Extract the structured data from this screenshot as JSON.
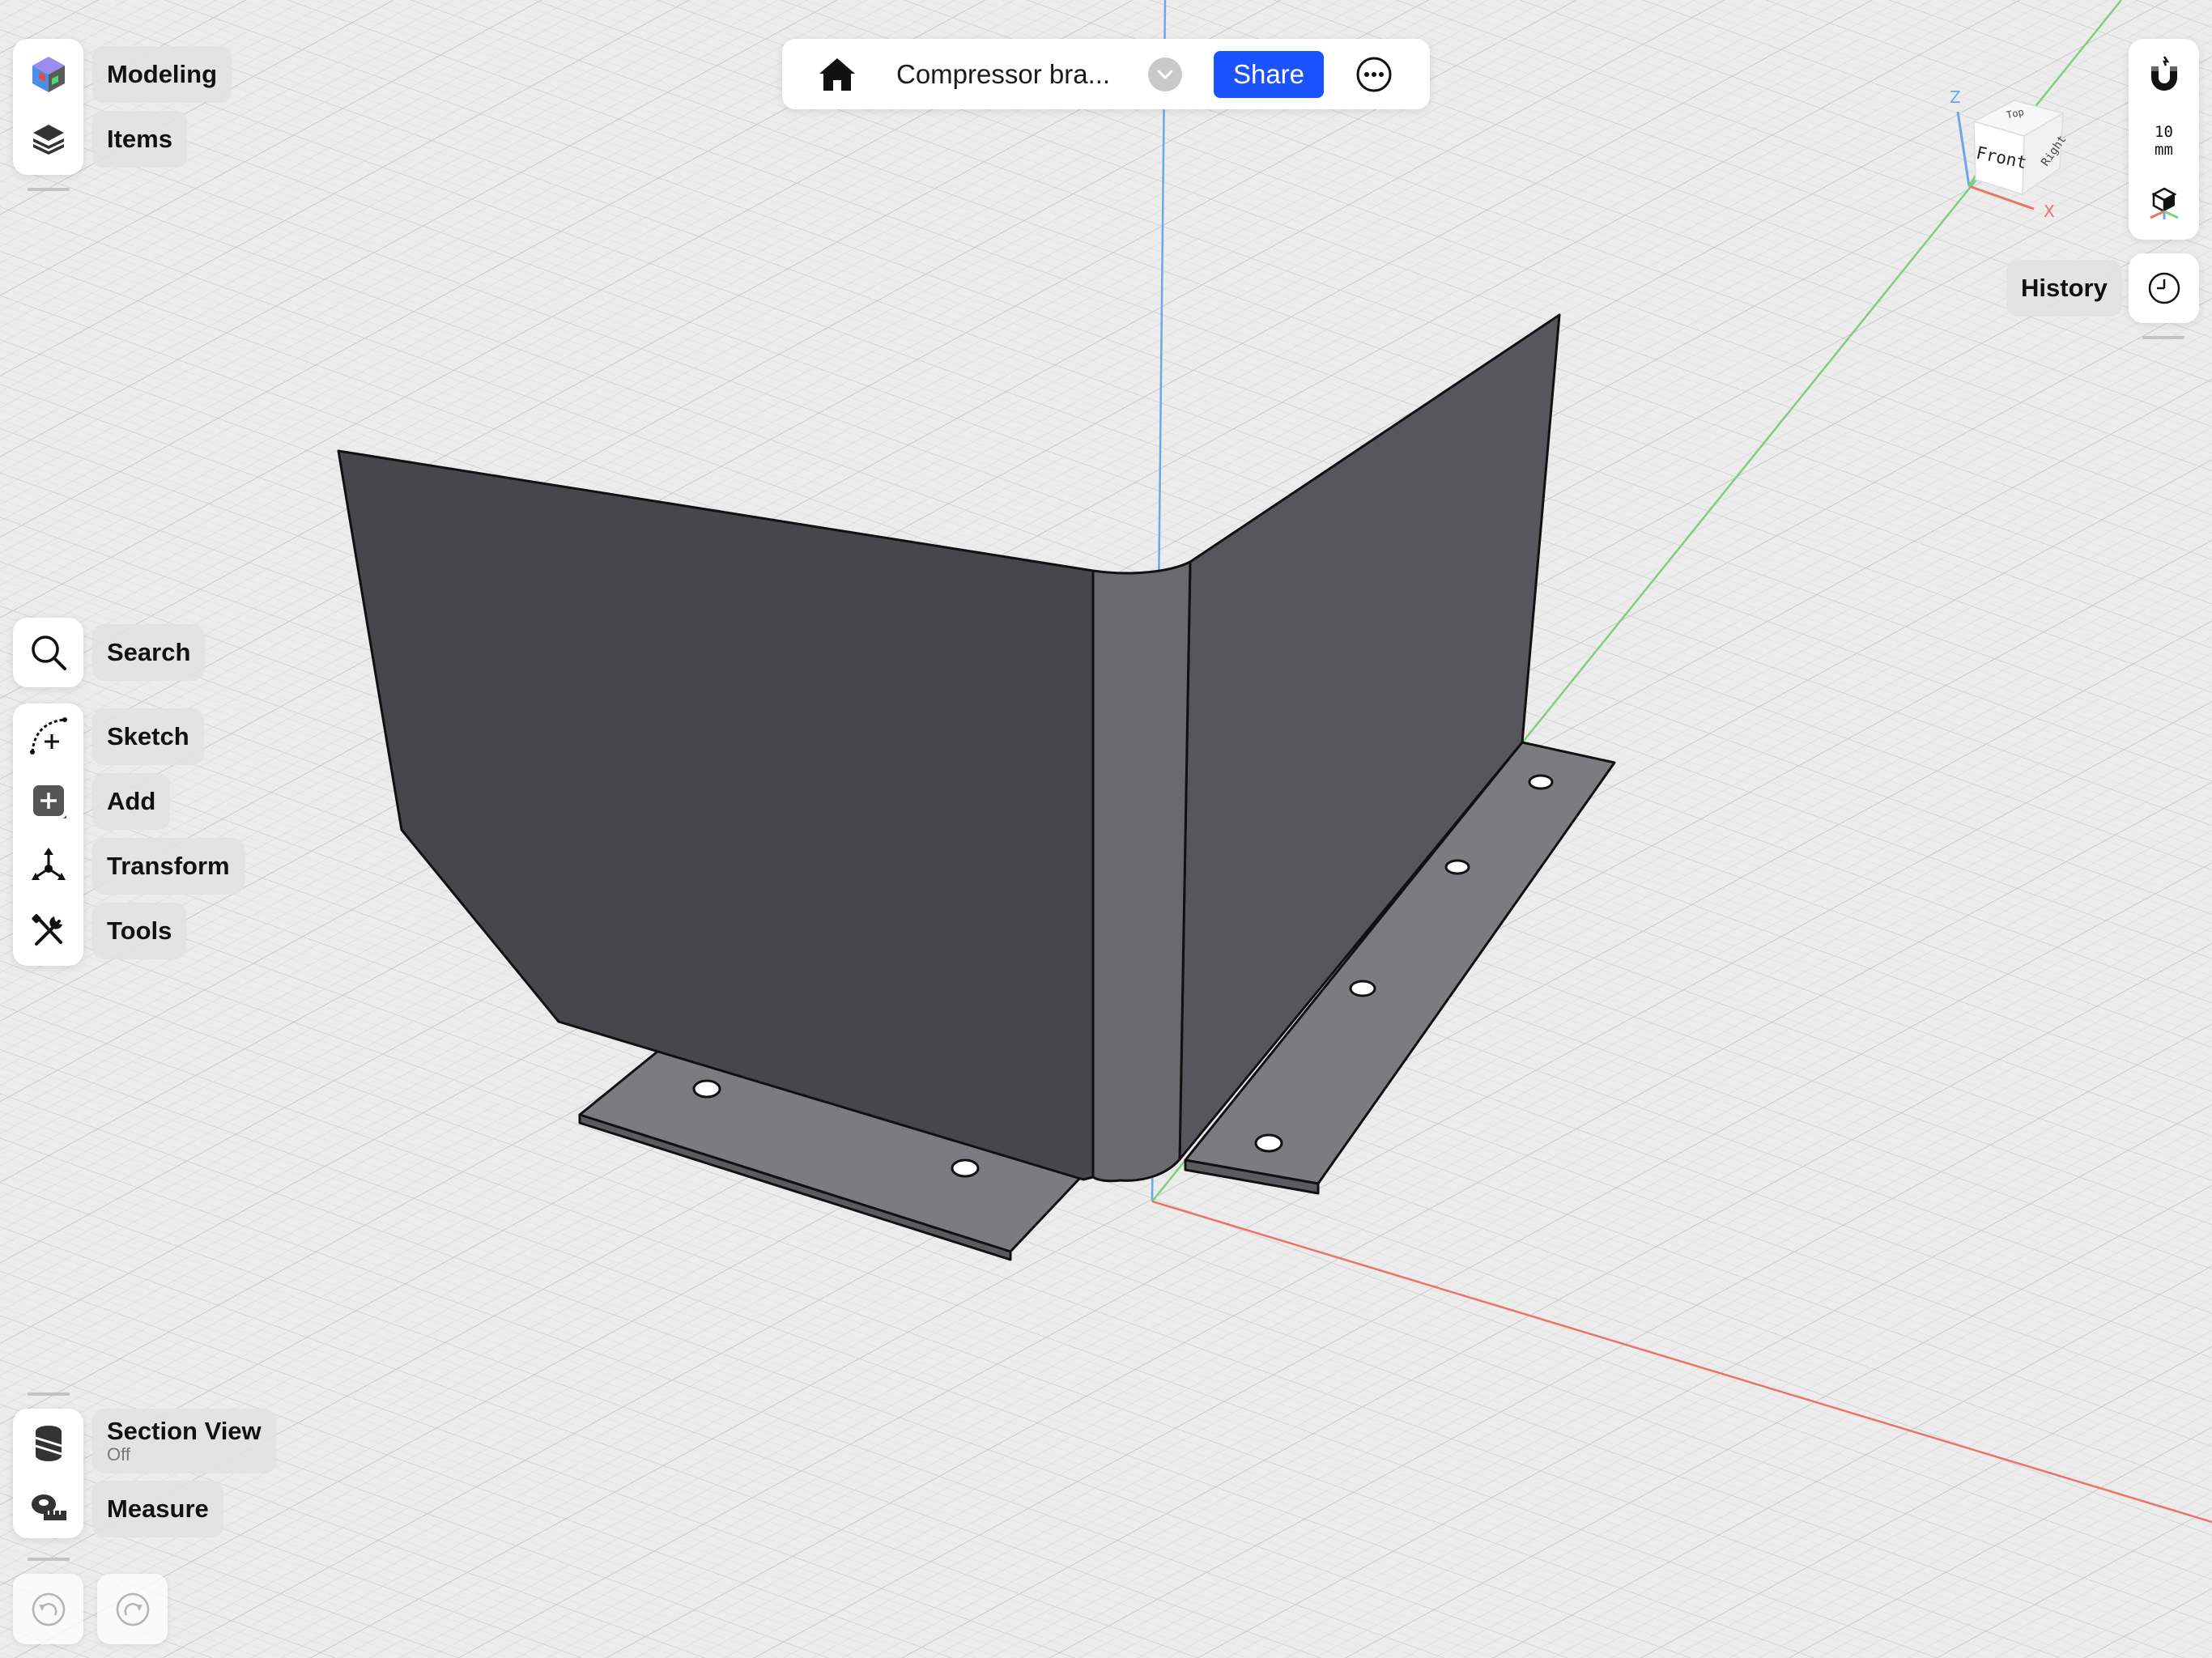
{
  "document": {
    "title": "Compressor bra..."
  },
  "topbar": {
    "share_label": "Share"
  },
  "workspace_menu": {
    "mode_label": "Modeling",
    "items_label": "Items"
  },
  "tools_menu": {
    "search_label": "Search",
    "sketch_label": "Sketch",
    "add_label": "Add",
    "transform_label": "Transform",
    "tools_label": "Tools"
  },
  "bottom_menu": {
    "section_view_label": "Section View",
    "section_view_state": "Off",
    "measure_label": "Measure"
  },
  "right_panel": {
    "units_value": "10",
    "units_unit": "mm",
    "history_label": "History"
  },
  "view_cube": {
    "front_label": "Front",
    "right_label": "Right",
    "top_label": "Top",
    "axis_z": "Z",
    "axis_x": "X"
  },
  "colors": {
    "accent": "#1a52ff",
    "axis_x": "#e8746a",
    "axis_y": "#7fcf7f",
    "axis_z": "#6aa8e8",
    "part_face_dark": "#47464b",
    "part_face_light": "#57565c",
    "part_flange": "#7c7b80"
  },
  "icons": [
    "home-icon",
    "chevron-down-icon",
    "more-icon",
    "modeling-cube-icon",
    "layers-icon",
    "search-icon",
    "sketch-icon",
    "add-icon",
    "transform-icon",
    "tools-icon",
    "section-view-icon",
    "measure-icon",
    "undo-icon",
    "redo-icon",
    "snap-magnet-icon",
    "view-axes-icon",
    "history-clock-icon"
  ]
}
